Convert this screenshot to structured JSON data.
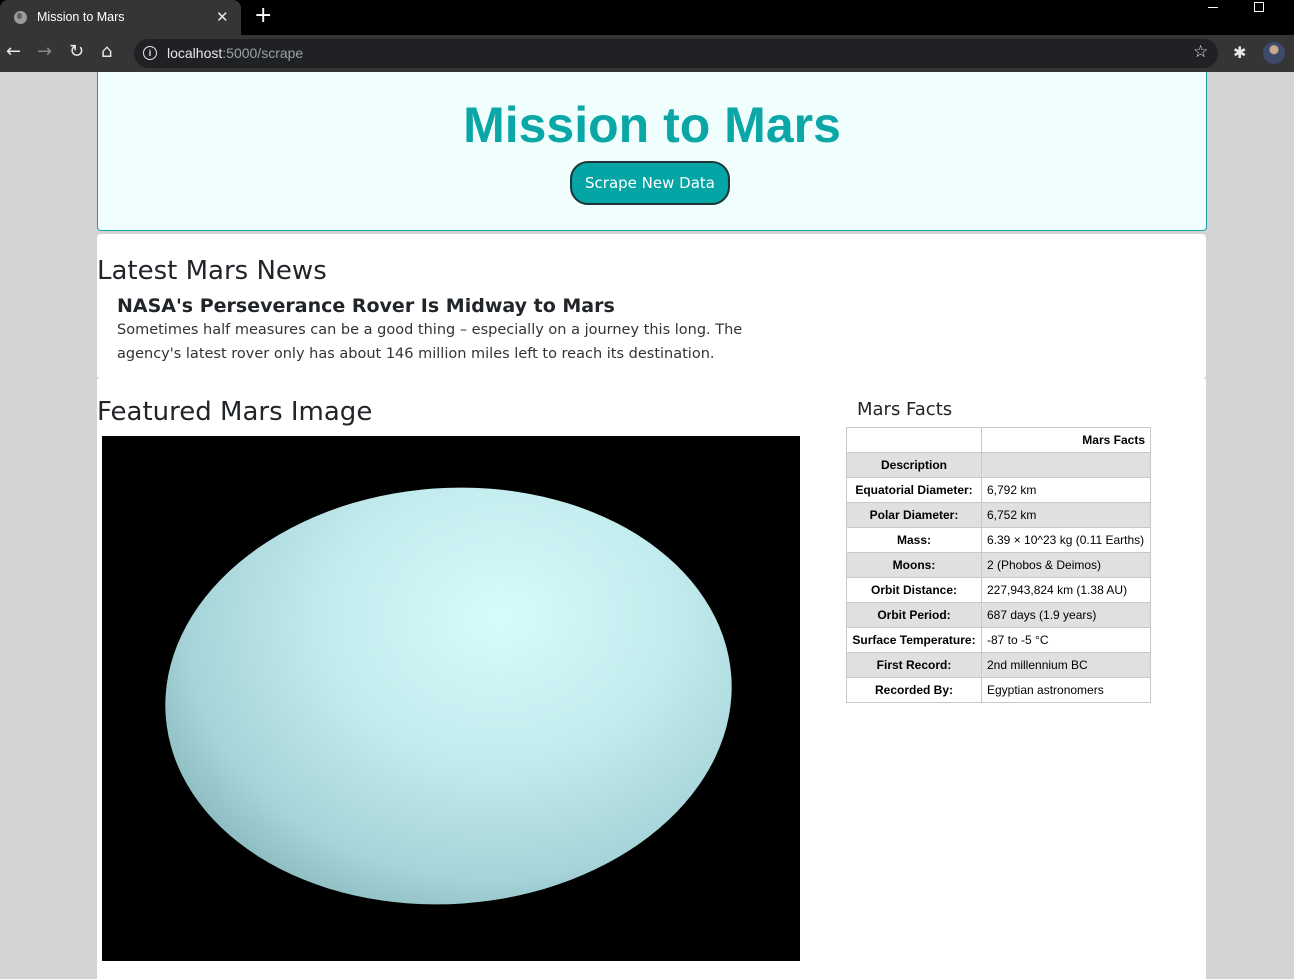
{
  "browser": {
    "tab_title": "Mission to Mars",
    "tab_close": "✕",
    "new_tab": "+",
    "url_host": "localhost",
    "url_path": ":5000/scrape",
    "info_glyph": "i",
    "icons": {
      "back": "←",
      "forward": "→",
      "reload": "↻",
      "home": "⌂",
      "star": "☆",
      "extensions": "✱"
    }
  },
  "header": {
    "title": "Mission to Mars",
    "scrape_button": "Scrape New Data"
  },
  "news": {
    "section_title": "Latest Mars News",
    "headline": "NASA's Perseverance Rover Is Midway to Mars",
    "paragraph": "Sometimes half measures can be a good thing – especially on a journey this long. The agency's latest rover only has about 146 million miles left to reach its destination."
  },
  "featured": {
    "section_title": "Featured Mars Image"
  },
  "facts": {
    "section_title": "Mars Facts",
    "header_value": "Mars Facts",
    "rows": [
      {
        "key": "Description",
        "value": ""
      },
      {
        "key": "Equatorial Diameter:",
        "value": "6,792 km"
      },
      {
        "key": "Polar Diameter:",
        "value": "6,752 km"
      },
      {
        "key": "Mass:",
        "value": "6.39 × 10^23 kg (0.11 Earths)"
      },
      {
        "key": "Moons:",
        "value": "2 (Phobos & Deimos)"
      },
      {
        "key": "Orbit Distance:",
        "value": "227,943,824 km (1.38 AU)"
      },
      {
        "key": "Orbit Period:",
        "value": "687 days (1.9 years)"
      },
      {
        "key": "Surface Temperature:",
        "value": "-87 to -5 °C"
      },
      {
        "key": "First Record:",
        "value": "2nd millennium BC"
      },
      {
        "key": "Recorded By:",
        "value": "Egyptian astronomers"
      }
    ]
  },
  "colors": {
    "accent": "#0ba7a7",
    "button": "#06a5a5",
    "jumbotron_bg": "#f0fffe",
    "page_bg": "#d3d3d3"
  }
}
